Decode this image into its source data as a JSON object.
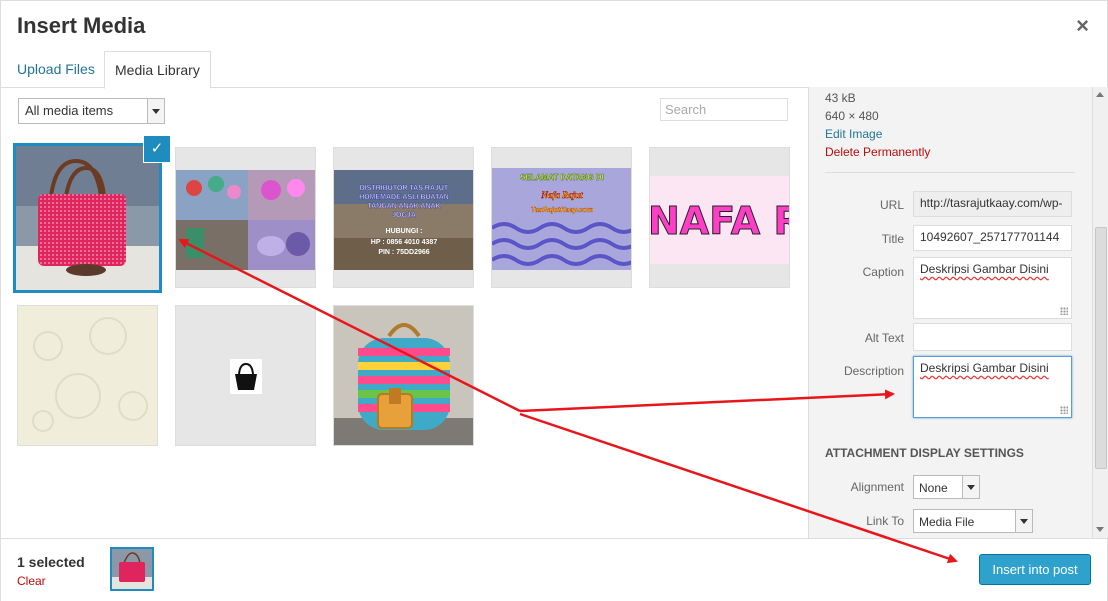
{
  "modal": {
    "title": "Insert Media",
    "close_label": "×"
  },
  "tabs": [
    {
      "label": "Upload Files"
    },
    {
      "label": "Media Library"
    }
  ],
  "toolbar": {
    "filter_value": "All media items",
    "search_placeholder": "Search"
  },
  "attachment_details": {
    "size": "43 kB",
    "dimensions": "640 × 480",
    "edit_link": "Edit Image",
    "delete_link": "Delete Permanently",
    "fields": {
      "url_label": "URL",
      "url_value": "http://tasrajutkaay.com/wp-",
      "title_label": "Title",
      "title_value": "10492607_257177701144",
      "caption_label": "Caption",
      "caption_value": "Deskripsi Gambar Disini",
      "alt_label": "Alt Text",
      "alt_value": "",
      "description_label": "Description",
      "description_value": "Deskripsi Gambar Disini"
    }
  },
  "display_settings": {
    "heading": "ATTACHMENT DISPLAY SETTINGS",
    "alignment_label": "Alignment",
    "alignment_value": "None",
    "link_label": "Link To",
    "link_value": "Media File"
  },
  "media_texts": {
    "distributor": [
      "DISTRIBUTOR TAS RAJUT",
      "HOMEMADE ASLI BUATAN",
      "TANGAN ANAK ANAK",
      "JOGJA",
      "HUBUNGI :",
      "HP : 0856 4010 4387",
      "PIN : 75DD2966"
    ],
    "selamat": [
      "SELAMAT DATANG DI",
      "Nafa Rajut",
      "TasRajutKaay.com"
    ],
    "nafa_banner": "NAFA RA"
  },
  "footer": {
    "selected_text": "1 selected",
    "clear_label": "Clear",
    "insert_label": "Insert into post"
  },
  "colors": {
    "accent": "#1e8cbe",
    "primary_button": "#2ea2cc",
    "danger": "#bc0b0b",
    "annotation": "#e8161a"
  }
}
